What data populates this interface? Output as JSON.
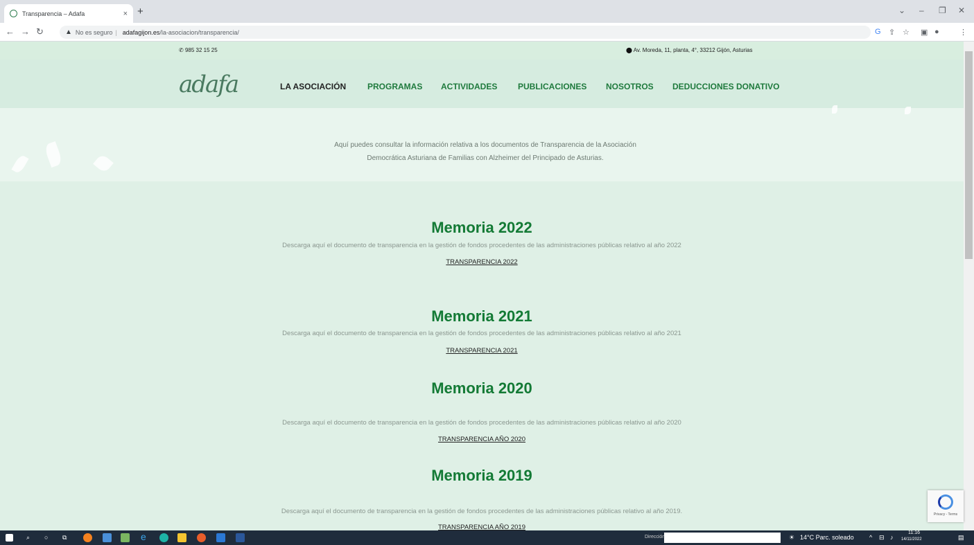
{
  "browser": {
    "tab_title": "Transparencia – Adafa",
    "tab_close": "×",
    "new_tab": "+",
    "security_label": "No es seguro",
    "url_host": "adafagijon.es",
    "url_path": "/la-asociacion/transparencia/",
    "window_controls": [
      "⌄",
      "–",
      "❐",
      "✕"
    ]
  },
  "topbar": {
    "phone": "985 32 15 25",
    "address": "Av. Moreda, 11, planta, 4°, 33212 Gijón, Asturias"
  },
  "header": {
    "logo_text": "adafa",
    "menu": [
      "LA ASOCIACIÓN",
      "PROGRAMAS",
      "ACTIVIDADES",
      "PUBLICACIONES",
      "NOSOTROS",
      "DEDUCCIONES DONATIVO"
    ]
  },
  "hero": {
    "line1": "Aquí puedes consultar la información relativa a los documentos de Transparencia de la Asociación",
    "line2": "Democrática Asturiana de Familias con Alzheimer del Principado de Asturias."
  },
  "memorias": [
    {
      "title": "Memoria 2022",
      "desc": "Descarga aquí el documento de transparencia en la gestión de fondos procedentes de las administraciones públicas relativo al año 2022",
      "link": "TRANSPARENCIA 2022"
    },
    {
      "title": "Memoria 2021",
      "desc": "Descarga aquí el documento de transparencia en la gestión de fondos procedentes de las administraciones públicas relativo al año 2021",
      "link": "TRANSPARENCIA 2021"
    },
    {
      "title": "Memoria 2020",
      "desc": "Descarga aquí el documento de transparencia en la gestión de fondos procedentes de las administraciones públicas relativo al año 2020",
      "link": "TRANSPARENCIA AÑO 2020"
    },
    {
      "title": "Memoria 2019",
      "desc": "Descarga aquí el documento de transparencia en la gestión de fondos procedentes de las administraciones públicas relativo al año 2019.",
      "link": "TRANSPARENCIA AÑO 2019"
    }
  ],
  "recaptcha": {
    "label": "Privacy - Terms"
  },
  "taskbar": {
    "address_label": "Dirección",
    "weather": "14°C Parc. soleado",
    "time": "11:16",
    "date": "14/11/2022"
  },
  "colors": {
    "brand_green": "#137a35",
    "page_bg": "#dff0e6"
  }
}
